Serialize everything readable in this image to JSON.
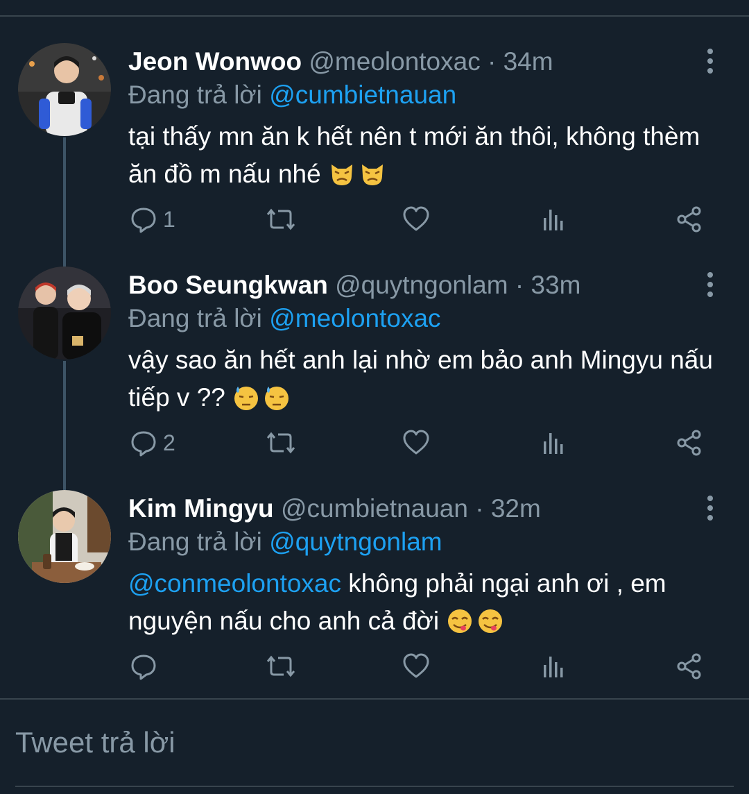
{
  "colors": {
    "background": "#15202b",
    "text_primary": "#ffffff",
    "text_secondary": "#8899a6",
    "accent": "#1da1f2",
    "divider": "#38444d"
  },
  "tweets": [
    {
      "display_name": "Jeon Wonwoo",
      "handle": "@meolontoxac",
      "separator": "·",
      "time": "34m",
      "reply_prefix": "Đang trả lời",
      "reply_to": "@cumbietnauan",
      "mention": "",
      "text": "tại thấy mn ăn k hết nên t mới ăn thôi, không thèm ăn đồ m nấu nhé",
      "emoji": [
        "cat-pouting-icon",
        "cat-pouting-icon"
      ],
      "replies": "1"
    },
    {
      "display_name": "Boo Seungkwan",
      "handle": "@quytngonlam",
      "separator": "·",
      "time": "33m",
      "reply_prefix": "Đang trả lời",
      "reply_to": "@meolontoxac",
      "mention": "",
      "text": "vậy sao ăn hết anh lại nhờ em bảo anh Mingyu nấu tiếp v ??",
      "emoji": [
        "downcast-sweat-face-icon",
        "downcast-sweat-face-icon"
      ],
      "replies": "2"
    },
    {
      "display_name": "Kim Mingyu",
      "handle": "@cumbietnauan",
      "separator": "·",
      "time": "32m",
      "reply_prefix": "Đang trả lời",
      "reply_to": "@quytngonlam",
      "mention": "@conmeolontoxac",
      "text": "không phải ngại anh ơi , em nguyện nấu cho anh cả đời",
      "emoji": [
        "yum-face-icon",
        "yum-face-icon"
      ],
      "replies": ""
    }
  ],
  "reply_box": {
    "placeholder": "Tweet trả lời"
  }
}
